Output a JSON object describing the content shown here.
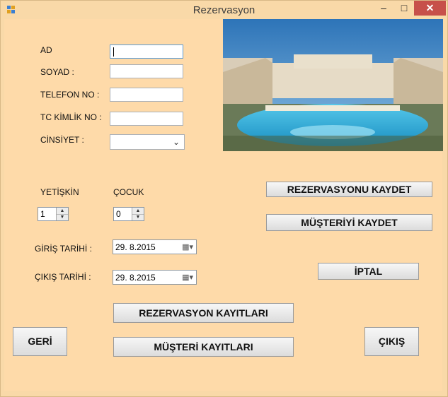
{
  "window": {
    "title": "Rezervasyon",
    "minimize": "–",
    "maximize": "□",
    "close": "✕"
  },
  "form": {
    "ad_label": "AD",
    "soyad_label": "SOYAD :",
    "telefon_label": "TELEFON NO :",
    "tc_label": "TC KİMLİK NO :",
    "cinsiyet_label": "CİNSİYET :",
    "yetiskin_label": "YETİŞKİN",
    "cocuk_label": "ÇOCUK",
    "yetiskin_value": "1",
    "cocuk_value": "0",
    "giris_label": "GİRİŞ TARİHİ :",
    "cikis_label": "ÇIKIŞ TARİHİ :",
    "giris_date": "29.  8.2015",
    "cikis_date": "29.  8.2015"
  },
  "buttons": {
    "rezervasyonu_kaydet": "REZERVASYONU KAYDET",
    "musteriyi_kaydet": "MÜŞTERİYİ KAYDET",
    "iptal": "İPTAL",
    "rezervasyon_kayitlari": "REZERVASYON KAYITLARI",
    "musteri_kayitlari": "MÜŞTERİ KAYITLARI",
    "geri": "GERİ",
    "cikis": "ÇIKIŞ"
  },
  "colors": {
    "background": "#fedaa9",
    "close_button": "#c7504a"
  }
}
